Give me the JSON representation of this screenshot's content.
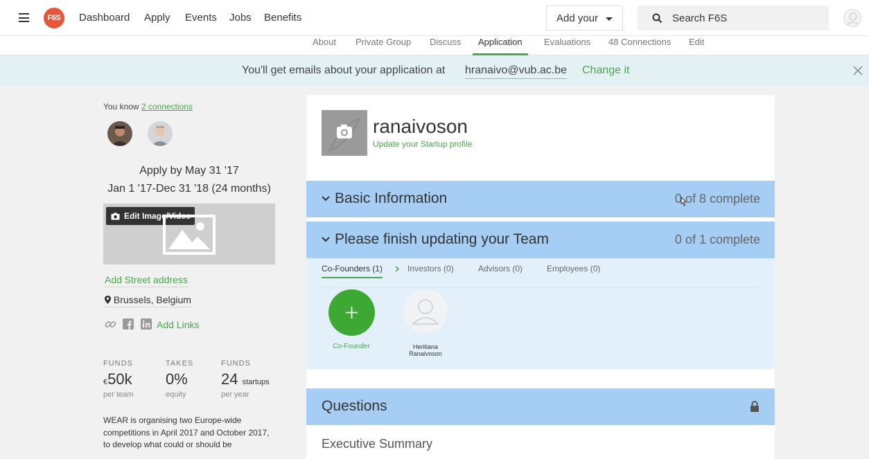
{
  "topnav": {
    "logo_text": "F6S",
    "links": [
      "Dashboard",
      "Apply",
      "Events",
      "Jobs",
      "Benefits"
    ],
    "add_your": "Add your",
    "search_placeholder": "Search F6S"
  },
  "subnav": {
    "tabs": [
      "About",
      "Private Group",
      "Discuss",
      "Application",
      "Evaluations",
      "48 Connections",
      "Edit"
    ],
    "active": "Application"
  },
  "banner": {
    "text": "You'll get emails about your application at",
    "email": "hranaivo@vub.ac.be",
    "change": "Change it"
  },
  "left": {
    "know_prefix": "You know",
    "know_link": "2 connections",
    "apply_by": "Apply by May 31 '17",
    "period": "Jan 1 '17-Dec 31 '18 (24 months)",
    "edit_media": "Edit Image/Video",
    "add_street": "Add Street address",
    "location": "Brussels, Belgium",
    "add_links": "Add Links",
    "stats": [
      {
        "label": "FUNDS",
        "prefix": "€",
        "value": "50k",
        "suffix": "",
        "sub": "per team"
      },
      {
        "label": "TAKES",
        "prefix": "",
        "value": "0%",
        "suffix": "",
        "sub": "equity"
      },
      {
        "label": "FUNDS",
        "prefix": "",
        "value": "24",
        "suffix": "startups",
        "sub": "per year"
      }
    ],
    "description": "WEAR is organising two Europe-wide competitions in April 2017 and October 2017, to develop what could or should be"
  },
  "card": {
    "startup_name": "ranaivoson",
    "update_profile": "Update your Startup profile",
    "sections": [
      {
        "title": "Basic Information",
        "progress": "0 of 8 complete"
      },
      {
        "title": "Please finish updating your Team",
        "progress": "0 of 1 complete"
      }
    ],
    "team_tabs": [
      "Co-Founders (1)",
      "Investors (0)",
      "Advisors (0)",
      "Employees (0)"
    ],
    "add_founder_label": "Co-Founder",
    "member_first": "Heritiana",
    "member_last": "Ranaivoson",
    "questions": "Questions",
    "exec_summary": "Executive Summary"
  },
  "colors": {
    "accent_green": "#4aa64a",
    "section_blue": "#a6cdf3",
    "banner_bg": "#e3f1f5",
    "logo_red": "#e8563b"
  }
}
